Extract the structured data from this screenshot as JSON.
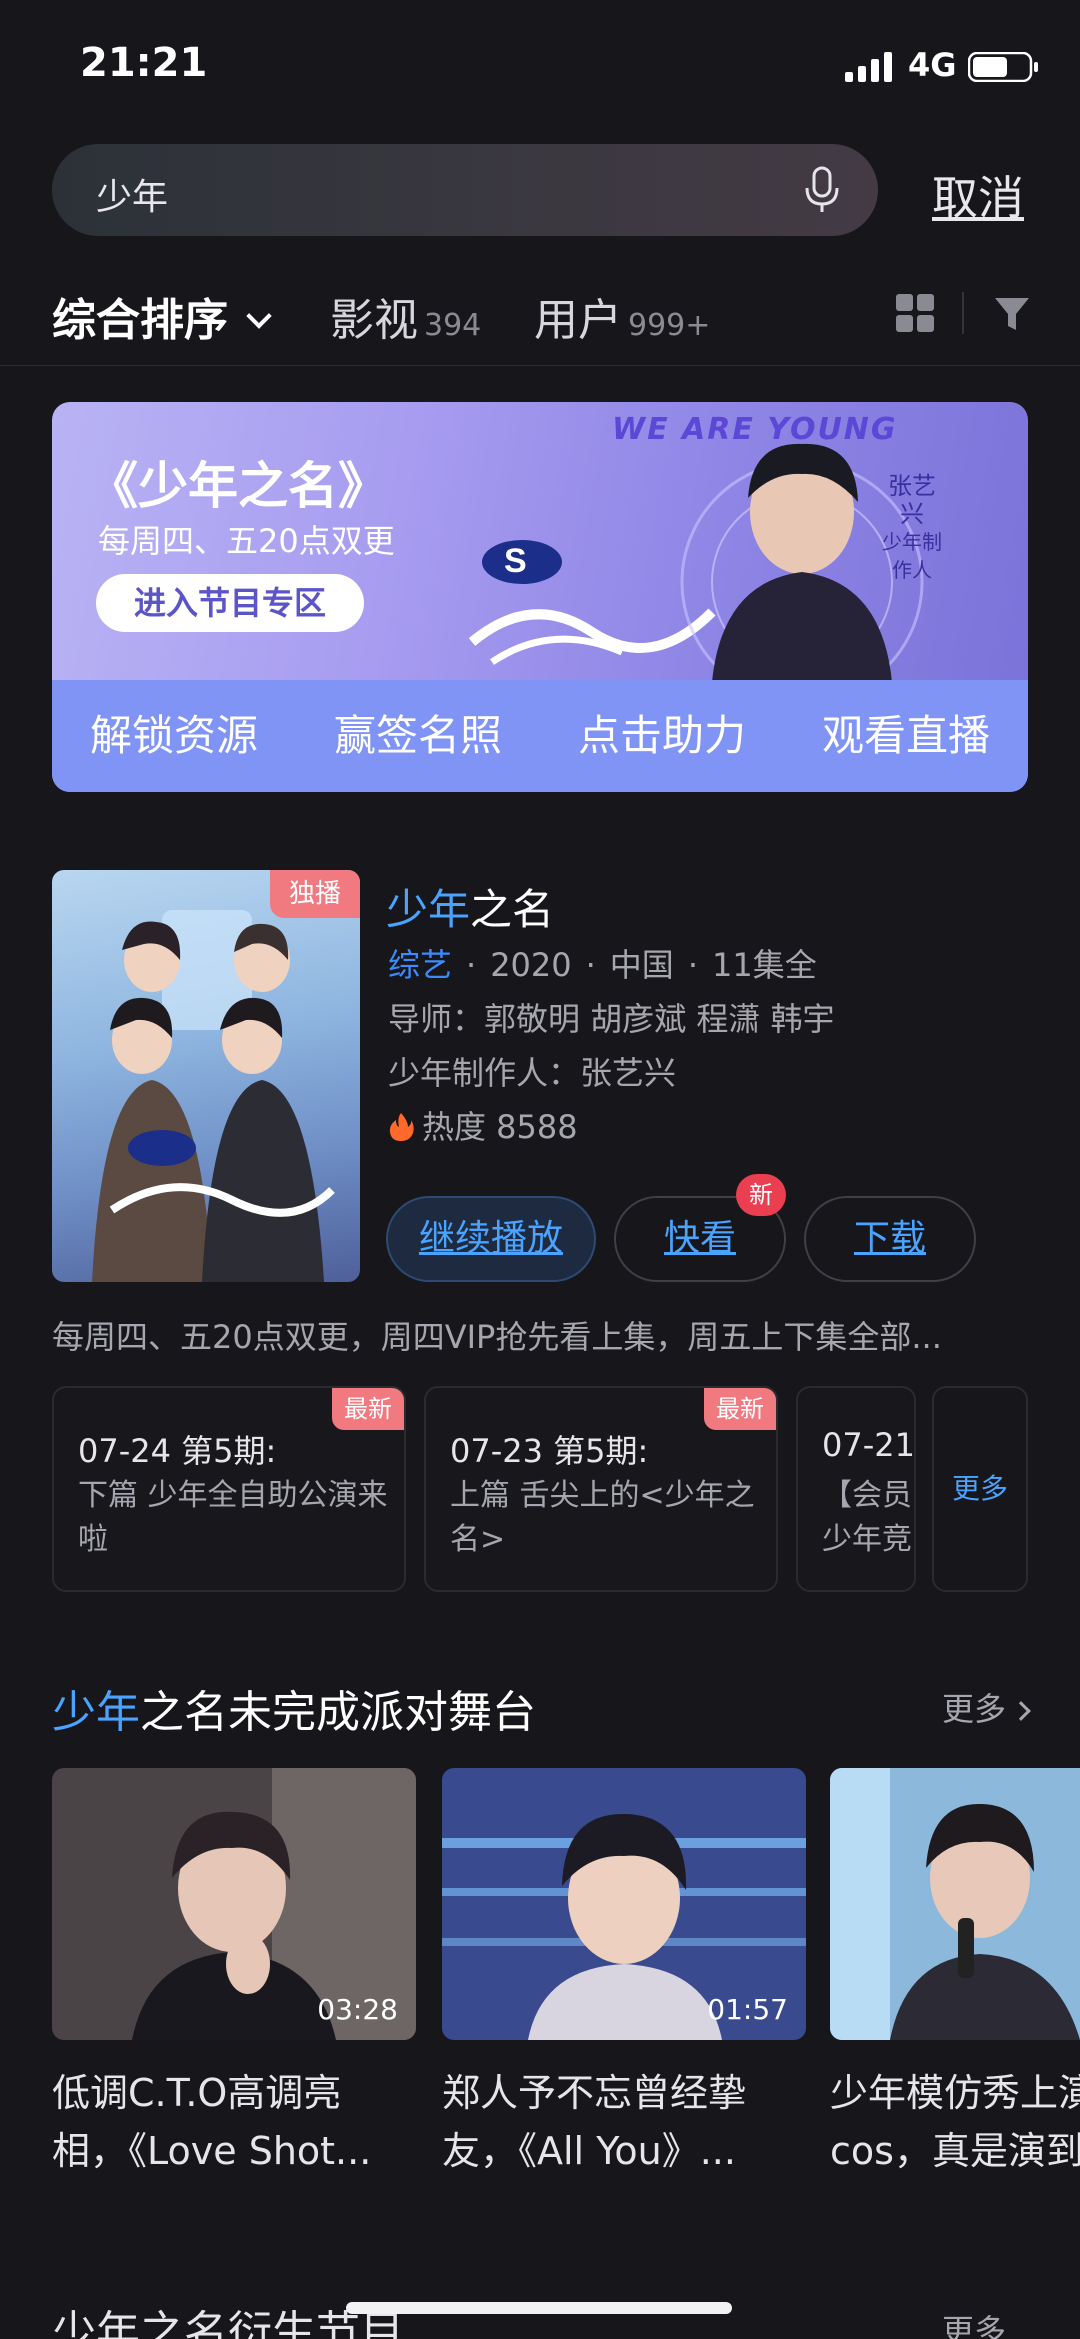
{
  "status": {
    "time": "21:21",
    "network": "4G"
  },
  "search": {
    "query": "少年",
    "cancel": "取消"
  },
  "filters": {
    "sort": "综合排序",
    "tabs": [
      {
        "label": "影视",
        "count": "394"
      },
      {
        "label": "用户",
        "count": "999+"
      }
    ]
  },
  "banner": {
    "title": "《少年之名》",
    "subtitle": "每周四、五20点双更",
    "enter": "进入节目专区",
    "we_are_young": "WE ARE YOUNG",
    "tag_name": "张艺兴",
    "tag_role": "少年制作人",
    "actions": [
      "解锁资源",
      "赢签名照",
      "点击助力",
      "观看直播"
    ]
  },
  "show": {
    "poster_badge": "独播",
    "title_hl": "少年",
    "title_rest": "之名",
    "genre": "综艺",
    "year": "2020",
    "region": "中国",
    "episodes": "11集全",
    "mentors_label": "导师：",
    "mentors": "郭敬明 胡彦斌 程潇 韩宇",
    "producer": "少年制作人：张艺兴",
    "heat": "热度 8588",
    "btn_play": "继续播放",
    "btn_quick": "快看",
    "btn_quick_badge": "新",
    "btn_download": "下载",
    "description": "每周四、五20点双更，周四VIP抢先看上集，周五上下集全部..."
  },
  "episodes": [
    {
      "badge": "最新",
      "head": "07-24 第5期:",
      "desc": "下篇 少年全自助公演来啦"
    },
    {
      "badge": "最新",
      "head": "07-23 第5期:",
      "desc": "上篇 舌尖上的<少年之名>"
    },
    {
      "badge": "",
      "head": "07-21",
      "desc": "【会员少年竞"
    }
  ],
  "episodes_more": "更多",
  "section": {
    "title_hl": "少年",
    "title_rest": "之名未完成派对舞台",
    "more": "更多",
    "videos": [
      {
        "duration": "03:28",
        "title1": "低调C.T.O高调亮",
        "title2": "相，《Love Shot..."
      },
      {
        "duration": "01:57",
        "title1": "郑人予不忘曾经挚",
        "title2": "友，《All You》..."
      },
      {
        "duration": "",
        "title1": "少年模仿秀上演",
        "title2": "cos，真是演到"
      }
    ]
  },
  "next_section": {
    "title": "少年之名衍生节目",
    "more": "更多"
  },
  "colors": {
    "accent": "#4aa3ff",
    "badge": "#f07a80",
    "background": "#16161b"
  }
}
